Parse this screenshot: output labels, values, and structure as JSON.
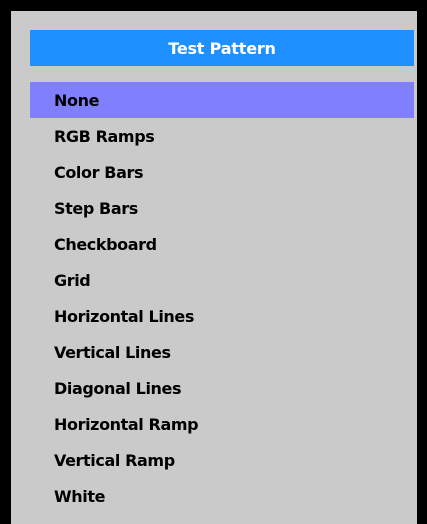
{
  "title": "Test Pattern",
  "colors": {
    "frame": "#000000",
    "panel": "#cacaca",
    "title_bar": "#1e90ff",
    "selected_row": "#8080ff"
  },
  "menu": {
    "selected_index": 0,
    "items": [
      {
        "label": "None"
      },
      {
        "label": "RGB Ramps"
      },
      {
        "label": "Color Bars"
      },
      {
        "label": "Step Bars"
      },
      {
        "label": "Checkboard"
      },
      {
        "label": "Grid"
      },
      {
        "label": "Horizontal Lines"
      },
      {
        "label": "Vertical Lines"
      },
      {
        "label": "Diagonal Lines"
      },
      {
        "label": "Horizontal Ramp"
      },
      {
        "label": "Vertical Ramp"
      },
      {
        "label": "White"
      }
    ]
  }
}
